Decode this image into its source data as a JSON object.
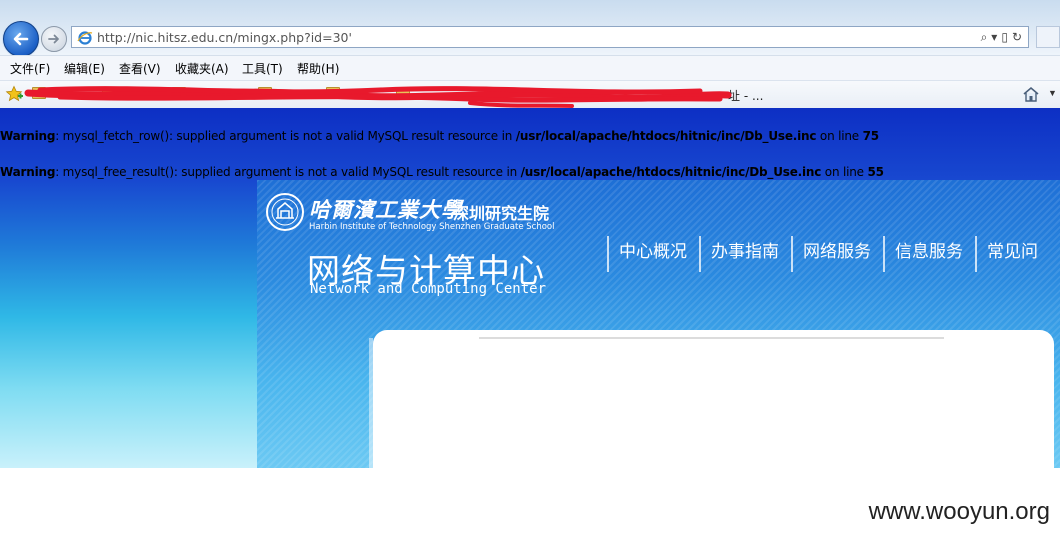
{
  "browser": {
    "url": "http://nic.hitsz.edu.cn/mingx.php?id=30'",
    "menu": [
      "文件(F)",
      "编辑(E)",
      "查看(V)",
      "收藏夹(A)",
      "工具(T)",
      "帮助(H)"
    ],
    "favorites_tail": "址 - ...",
    "address_tools": [
      "search-icon",
      "dropdown-icon",
      "refresh-icon"
    ]
  },
  "page": {
    "warnings": [
      {
        "label": "Warning",
        "message": ": mysql_fetch_row(): supplied argument is not a valid MySQL result resource in ",
        "path": "/usr/local/apache/htdocs/hitnic/inc/Db_Use.inc",
        "on_line": " on line ",
        "line": "75"
      },
      {
        "label": "Warning",
        "message": ": mysql_free_result(): supplied argument is not a valid MySQL result resource in ",
        "path": "/usr/local/apache/htdocs/hitnic/inc/Db_Use.inc",
        "on_line": " on line ",
        "line": "55"
      }
    ],
    "header": {
      "university_cn": "哈爾濱工業大學",
      "campus_cn": "深圳研究生院",
      "university_en": "Harbin Institute of Technology Shenzhen Graduate School",
      "center_cn": "网络与计算中心",
      "center_en": "Network and Computing Center"
    },
    "nav": [
      "中心概况",
      "办事指南",
      "网络服务",
      "信息服务",
      "常见问"
    ]
  },
  "watermark": "www.wooyun.org",
  "colors": {
    "page_top": "#0d2fc4",
    "page_bottom": "#c9f1fb",
    "redaction": "#e8192c"
  }
}
